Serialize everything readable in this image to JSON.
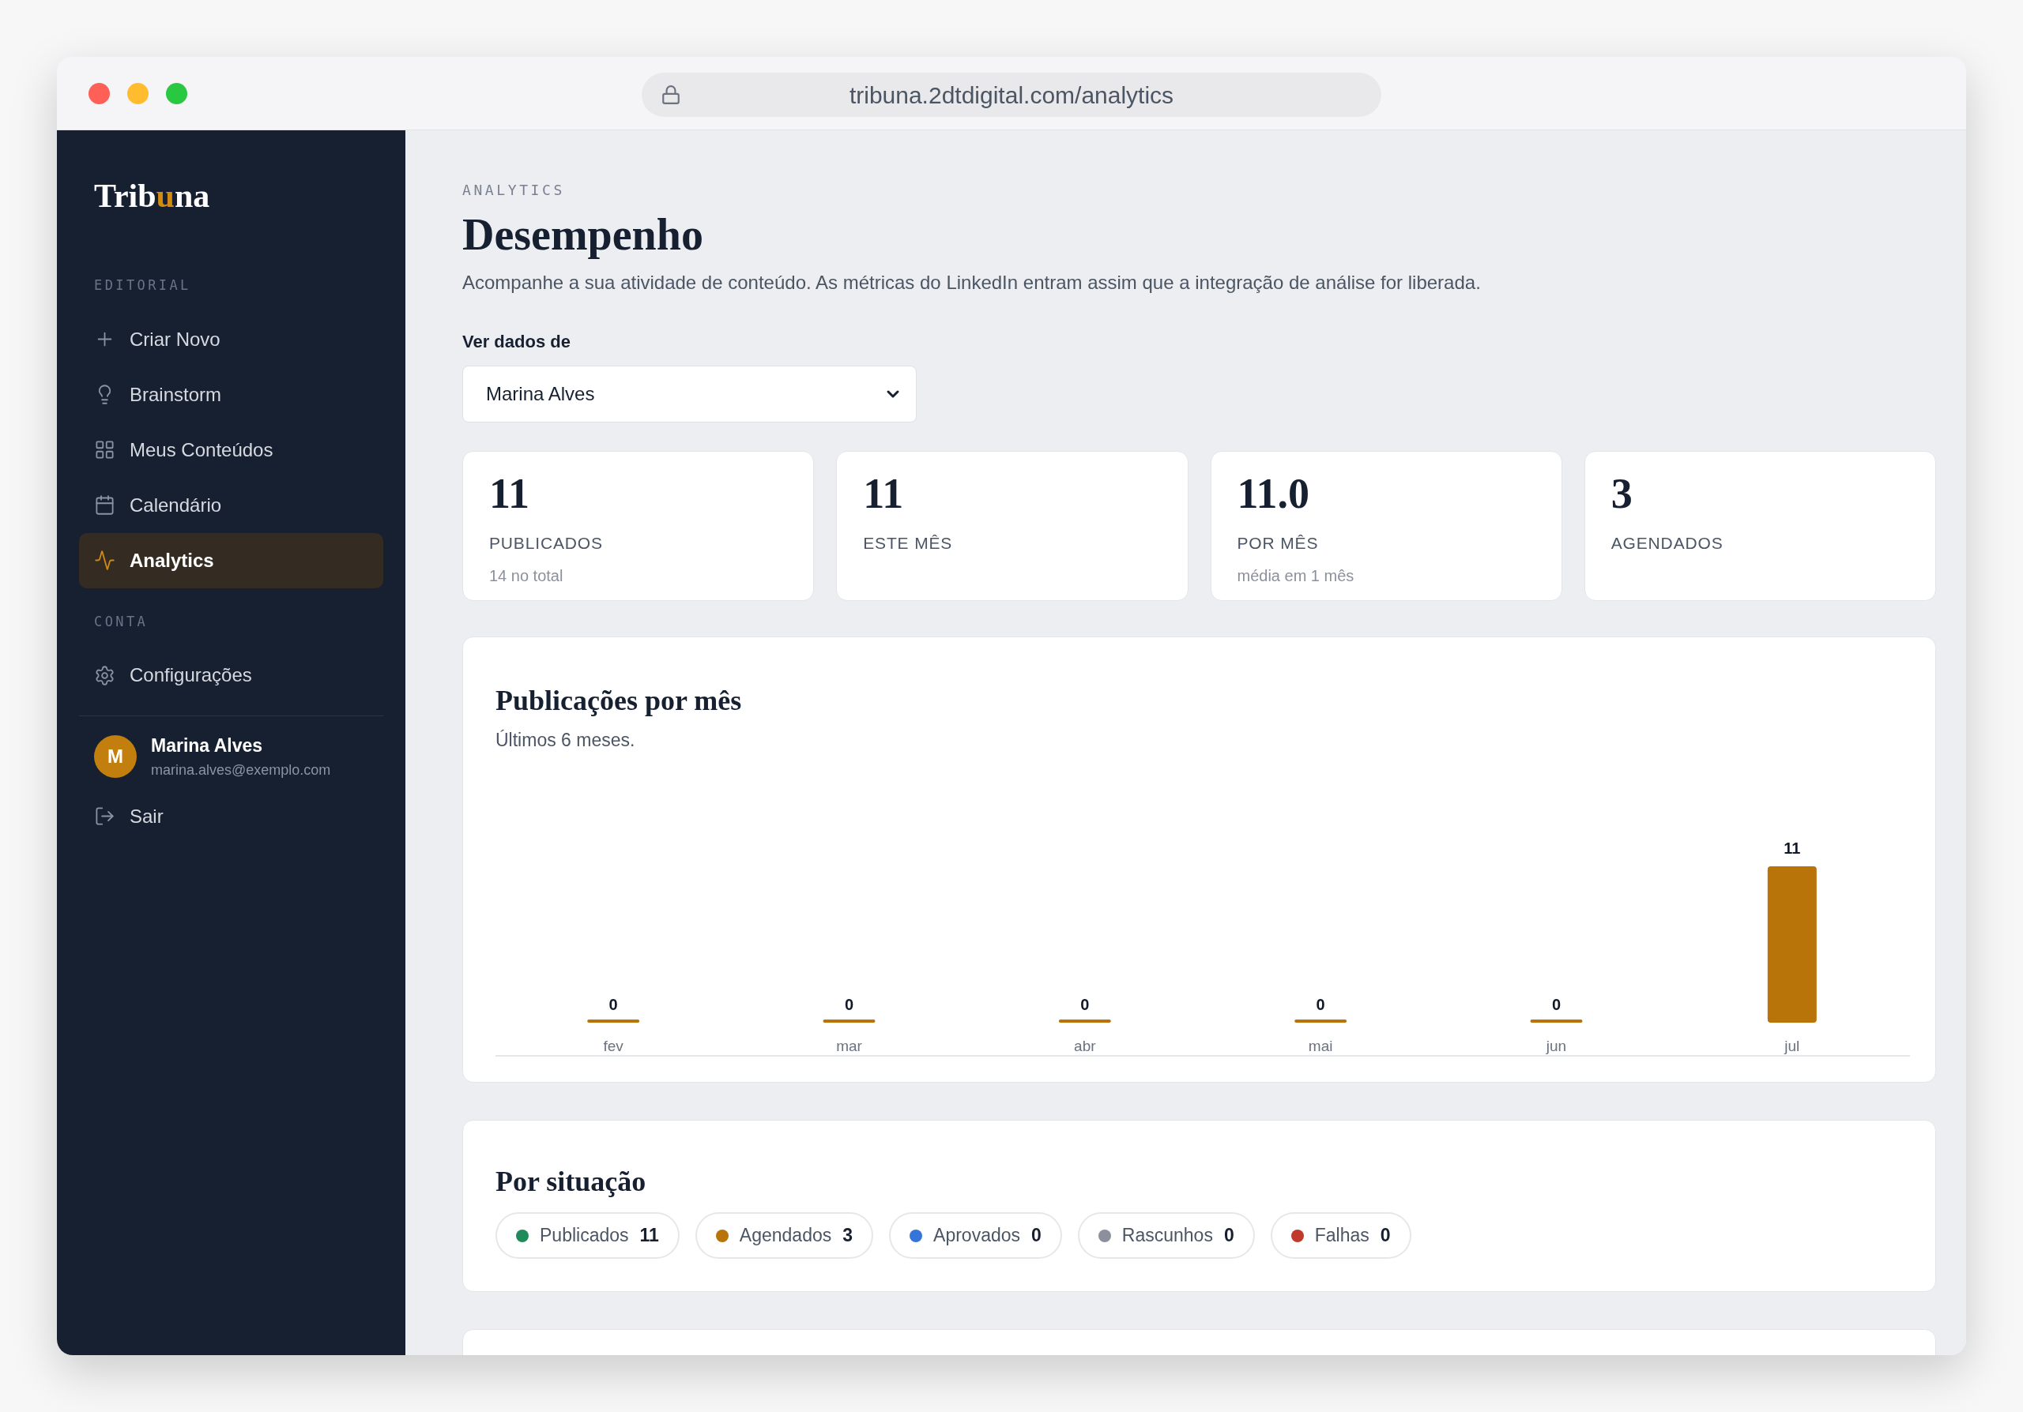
{
  "browser": {
    "url": "tribuna.2dtdigital.com/analytics"
  },
  "sidebar": {
    "logo": [
      {
        "text": "Trib",
        "accent": false
      },
      {
        "text": "u",
        "accent": true
      },
      {
        "text": "na",
        "accent": false
      }
    ],
    "sections": [
      {
        "label": "EDITORIAL",
        "items": [
          {
            "label": "Criar Novo",
            "selected": false
          },
          {
            "label": "Brainstorm",
            "selected": false
          },
          {
            "label": "Meus Conteúdos",
            "selected": false
          },
          {
            "label": "Calendário",
            "selected": false
          },
          {
            "label": "Analytics",
            "selected": true
          }
        ]
      },
      {
        "label": "CONTA",
        "items": [
          {
            "label": "Configurações",
            "selected": false
          }
        ]
      }
    ],
    "user": {
      "initial": "M",
      "name": "Marina Alves",
      "email": "marina.alves@exemplo.com"
    },
    "logout": "Sair"
  },
  "page": {
    "eyebrow": "ANALYTICS",
    "title": "Desempenho",
    "description": "Acompanhe a sua atividade de conteúdo. As métricas do LinkedIn entram assim que a integração de análise for liberada.",
    "filter": {
      "label": "Ver dados de",
      "value": "Marina Alves"
    }
  },
  "stats": [
    {
      "value": "11",
      "label": "PUBLICADOS",
      "note": "14 no total"
    },
    {
      "value": "11",
      "label": "ESTE MÊS"
    },
    {
      "value": "11.0",
      "label": "POR MÊS",
      "note": "média em 1 mês"
    },
    {
      "value": "3",
      "label": "AGENDADOS"
    }
  ],
  "monthly": {
    "title": "Publicações por mês",
    "subtitle": "Últimos 6 meses.",
    "chart_data": {
      "type": "bar",
      "categories": [
        "fev",
        "mar",
        "abr",
        "mai",
        "jun",
        "jul"
      ],
      "values": [
        0,
        0,
        0,
        0,
        0,
        11
      ],
      "data_labels": true
    }
  },
  "status": {
    "title": "Por situação",
    "items": [
      {
        "label": "Publicados",
        "count": "11",
        "color": "#1f8a5b"
      },
      {
        "label": "Agendados",
        "count": "3",
        "color": "#b87408"
      },
      {
        "label": "Aprovados",
        "count": "0",
        "color": "#3574d8"
      },
      {
        "label": "Rascunhos",
        "count": "0",
        "color": "#8b909c"
      },
      {
        "label": "Falhas",
        "count": "0",
        "color": "#c0392b"
      }
    ]
  }
}
